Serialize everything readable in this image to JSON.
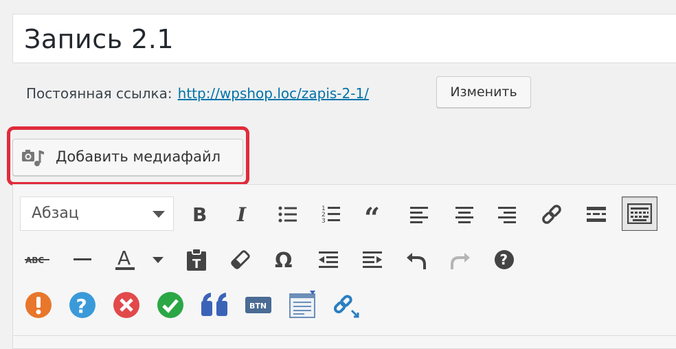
{
  "post": {
    "title": "Запись 2.1"
  },
  "permalink": {
    "label": "Постоянная ссылка:",
    "url": "http://wpshop.loc/zapis-2-1/",
    "edit_label": "Изменить"
  },
  "media": {
    "label": "Добавить медиафайл",
    "icon": "add-media-icon",
    "highlight_color": "#e02b3b"
  },
  "toolbar": {
    "format_select": {
      "value": "Абзац"
    },
    "row1": [
      {
        "name": "bold",
        "icon": "bold-icon"
      },
      {
        "name": "italic",
        "icon": "italic-icon"
      },
      {
        "name": "bullet-list",
        "icon": "bullet-list-icon"
      },
      {
        "name": "numbered-list",
        "icon": "numbered-list-icon"
      },
      {
        "name": "blockquote",
        "icon": "blockquote-icon"
      },
      {
        "name": "align-left",
        "icon": "align-left-icon"
      },
      {
        "name": "align-center",
        "icon": "align-center-icon"
      },
      {
        "name": "align-right",
        "icon": "align-right-icon"
      },
      {
        "name": "link",
        "icon": "link-icon"
      },
      {
        "name": "read-more",
        "icon": "read-more-icon"
      },
      {
        "name": "toolbar-toggle",
        "icon": "kitchen-sink-icon",
        "active": true
      }
    ],
    "row2": [
      {
        "name": "strikethrough",
        "icon": "strikethrough-icon",
        "text": "ABC"
      },
      {
        "name": "horizontal-line",
        "icon": "horizontal-line-icon"
      },
      {
        "name": "text-color",
        "icon": "text-color-icon",
        "text": "A"
      },
      {
        "name": "paste-as-text",
        "icon": "paste-text-icon"
      },
      {
        "name": "clear-formatting",
        "icon": "eraser-icon"
      },
      {
        "name": "special-character",
        "icon": "omega-icon",
        "text": "Ω"
      },
      {
        "name": "outdent",
        "icon": "outdent-icon"
      },
      {
        "name": "indent",
        "icon": "indent-icon"
      },
      {
        "name": "undo",
        "icon": "undo-icon"
      },
      {
        "name": "redo",
        "icon": "redo-icon",
        "disabled": true
      },
      {
        "name": "help",
        "icon": "help-icon",
        "text": "?"
      }
    ],
    "row3": [
      {
        "name": "shortcode-warning",
        "icon": "exclamation-icon",
        "text": "!",
        "color": "#e8762b"
      },
      {
        "name": "shortcode-question",
        "icon": "question-icon",
        "text": "?",
        "color": "#3a9ad9"
      },
      {
        "name": "shortcode-error",
        "icon": "error-x-icon",
        "color": "#e2494b"
      },
      {
        "name": "shortcode-success",
        "icon": "check-icon",
        "color": "#2ba745"
      },
      {
        "name": "shortcode-quote",
        "icon": "quote-icon",
        "color": "#3b64b8"
      },
      {
        "name": "shortcode-button",
        "icon": "button-icon",
        "text": "BTN",
        "color": "#4a6b94"
      },
      {
        "name": "shortcode-block",
        "icon": "content-block-icon",
        "color": "#6b8fb8"
      },
      {
        "name": "shortcode-external-link",
        "icon": "external-link-icon",
        "color": "#2a7fc1"
      }
    ]
  }
}
